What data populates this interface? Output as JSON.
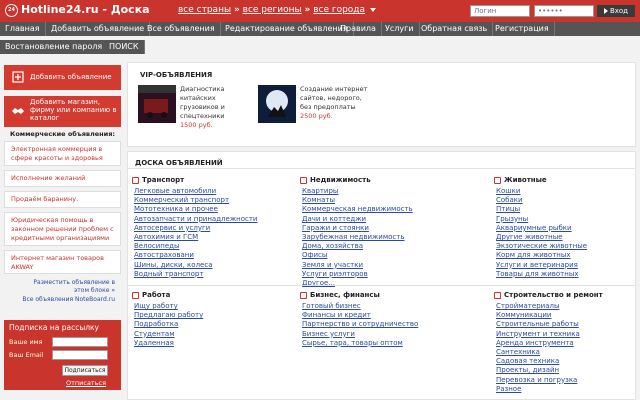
{
  "header": {
    "logo_badge": "24",
    "logo_text": "Hotline24.ru - Доска",
    "regions": [
      "все страны",
      "все регионы",
      "все города"
    ],
    "region_sep": "»",
    "login_placeholder": "Логин",
    "password_placeholder": "••••••",
    "enter_label": "Вход"
  },
  "nav": {
    "main": [
      "Главная",
      "Добавить объявление",
      "Все объявления",
      "Редактирование объявления",
      "Правила",
      "Услуги",
      "Обратная связь",
      "Регистрация"
    ],
    "secondary": [
      "Востановление пароля",
      "ПОИСК"
    ]
  },
  "sidebar": {
    "add_ad": "Добавить объявление",
    "add_shop": "Добавить магазин, фирму или компанию в каталог",
    "commercial_title": "Коммерческие объявления:",
    "commercial": [
      "Электронная коммерция в сфере красоты и здоровья",
      "Исполнение желаний",
      "Продаём баранину.",
      "Юридическая помощь в законном решении проблем с кредитными организациями",
      "Интернет магазин товаров AKWAY"
    ],
    "place_ad_link": "Разместить объявление в этом блоке »",
    "noteboard_link": "Все объявления NoteBoard.ru",
    "subscribe": {
      "title": "Подписка на рассылку",
      "name_label": "Ваше имя",
      "email_label": "Ваш Email",
      "subscribe_btn": "Подписаться",
      "unsubscribe": "Отписаться"
    }
  },
  "vip": {
    "title": "VIP-ОБЪЯВЛЕНИЯ",
    "items": [
      {
        "text": "Диагностика китайских грузовиков и спецтехники",
        "price": "1500 руб."
      },
      {
        "text": "Создание интернет сайтов, недорого, без предоплаты",
        "price": "2500 руб."
      }
    ]
  },
  "board": {
    "title": "ДОСКА ОБЪЯВЛЕНИЙ",
    "categories": [
      {
        "title": "Транспорт",
        "items": [
          "Легковые автомобили",
          "Коммерческий транспорт",
          "Мототехника и прочее",
          "Автозапчасти и принадлежности",
          "Автосервис и услуги",
          "Автохимия и ГСМ",
          "Велосипеды",
          "Автостраховани",
          "Шины, диски, колеса",
          "Водный транспорт"
        ]
      },
      {
        "title": "Недвижимость",
        "items": [
          "Квартиры",
          "Комнаты",
          "Коммерческая недвижимость",
          "Дачи и коттеджи",
          "Гаражи и стоянки",
          "Зарубежная недвижимость",
          "Дома, хозяйства",
          "Офисы",
          "Земля и участки",
          "Услуги риэлторов",
          "Другое..."
        ]
      },
      {
        "title": "Животные",
        "items": [
          "Кошки",
          "Собаки",
          "Птицы",
          "Грызуны",
          "Аквариумные рыбки",
          "Другие животные",
          "Экзотические животные",
          "Корм для животных",
          "Услуги и ветеринария",
          "Товары для животных"
        ]
      },
      {
        "title": "Работа",
        "items": [
          "Ищу работу",
          "Предлагаю работу",
          "Подработка",
          "Студентам",
          "Удаленная"
        ]
      },
      {
        "title": "Бизнес, финансы",
        "items": [
          "Готовый бизнес",
          "Финансы и кредит",
          "Партнерство и сотрудничество",
          "Бизнес услуги",
          "Сырье, тара, товары оптом"
        ]
      },
      {
        "title": "Строительство и ремонт",
        "items": [
          "Стройматериалы",
          "Коммуникации",
          "Строительные работы",
          "Инструмент и техника",
          "Аренда инструмента",
          "Сантехника",
          "Садовая техника",
          "Проекты, дизайн",
          "Перевозка и погрузка",
          "Разное"
        ]
      }
    ]
  },
  "colors": {
    "brand": "#c9342d",
    "nav": "#555555",
    "link": "#2b4aa6",
    "price": "#e0322a"
  }
}
